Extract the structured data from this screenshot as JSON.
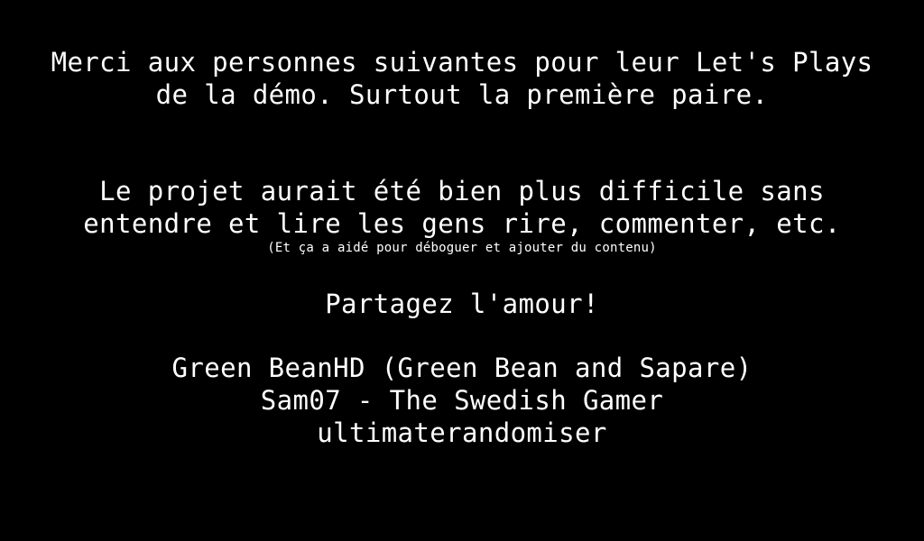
{
  "credits": {
    "thanks_line_1": "Merci aux personnes suivantes pour leur Let's Plays",
    "thanks_line_2": "de la démo. Surtout la première paire.",
    "project_line_1": "Le projet aurait été bien plus difficile sans",
    "project_line_2": "entendre et lire les gens rire, commenter, etc.",
    "note": "(Et ça a aidé pour déboguer et ajouter du contenu)",
    "share": "Partagez l'amour!",
    "names": [
      "Green BeanHD (Green Bean and Sapare)",
      "Sam07 - The Swedish Gamer",
      "ultimaterandomiser"
    ]
  },
  "colors": {
    "background": "#000000",
    "text": "#ffffff"
  }
}
